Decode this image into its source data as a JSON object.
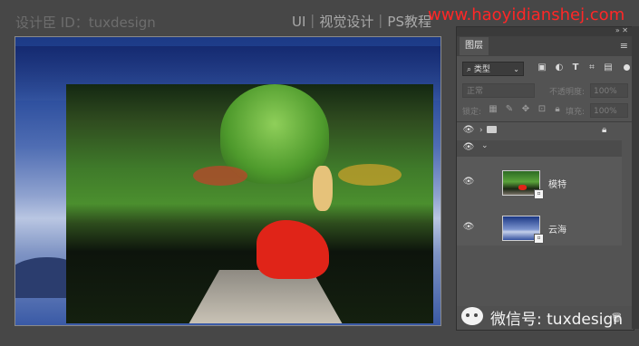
{
  "watermarks": {
    "left": "设计臣 ID：tuxdesign",
    "mid": "UI｜视觉设计｜PS教程",
    "url": "www.haoyidianshej.com"
  },
  "colors": {
    "accent_watermark": "#ff2727",
    "panel_bg": "#535353",
    "dress": "#e02418"
  },
  "panel": {
    "tab_label": "图层",
    "menu_icon": "hamburger-menu-icon",
    "filter": {
      "kind_label": "类型",
      "icons": [
        "image-filter-icon",
        "adjustment-filter-icon",
        "type-filter-icon",
        "shape-filter-icon",
        "smart-object-filter-icon"
      ]
    },
    "blend_mode": "正常",
    "opacity_label": "不透明度:",
    "opacity_value": "100%",
    "lock_label": "锁定:",
    "fill_label": "填充:",
    "fill_value": "100%",
    "layers": [
      {
        "type": "group",
        "name": "",
        "expanded": false,
        "locked": true
      },
      {
        "type": "group",
        "name": "",
        "expanded": true,
        "locked": false
      },
      {
        "type": "smart-object",
        "name": "模特",
        "thumbnail": "model-thumbnail"
      },
      {
        "type": "smart-object",
        "name": "云海",
        "thumbnail": "sea-of-clouds-thumbnail"
      }
    ]
  },
  "footer": {
    "wechat_label": "微信号: tuxdesign"
  }
}
